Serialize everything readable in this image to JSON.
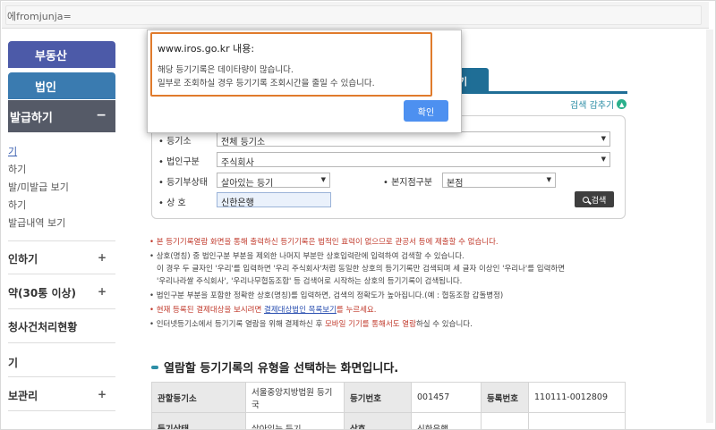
{
  "address_bar": {
    "url": "에fromjunja="
  },
  "sidebar": {
    "top_buttons": [
      "부동산",
      "법인"
    ],
    "active_section": {
      "label": "발급하기",
      "toggle": "−"
    },
    "sub_items": [
      "기",
      "하기",
      "발/미발급 보기",
      "하기",
      "발급내역 보기"
    ],
    "menus": [
      {
        "label": "인하기",
        "toggle": "+"
      },
      {
        "label": "약(30통 이상)",
        "toggle": "+"
      },
      {
        "label": "청사건처리현황",
        "toggle": ""
      },
      {
        "label": "기",
        "toggle": ""
      },
      {
        "label": "보관리",
        "toggle": "+"
      }
    ]
  },
  "tabs": {
    "partial_tab": "기"
  },
  "collapse_search": {
    "label": "검색 감추기"
  },
  "search_form": {
    "registry_office_label": "• 등기소",
    "registry_office_value": "전체 등기소",
    "corp_type_label": "• 법인구분",
    "corp_type_value": "주식회사",
    "registry_status_label": "• 등기부상태",
    "registry_status_value": "살아있는 등기",
    "branch_label": "• 본지점구분",
    "branch_value": "본점",
    "name_label": "• 상 호",
    "name_value": "신한은행",
    "search_button": "검색"
  },
  "notes": {
    "n1": "• 본 등기기록열람 화면을 통해 출력하신 등기기록은 법적인 효력이 없으므로 관공서 등에 제출할 수 없습니다.",
    "n2": "• 상호(명칭) 중 법인구분 부분을 제외한 나머지 부분만 상호입력란에 입력하여 검색할 수 있습니다.",
    "n3": "이 경우 두 글자인 '우리'를 입력하면 '우리 주식회사'처럼 동일한 상호의 등기기록만 검색되며 세 글자 이상인 '우리나'를 입력하면",
    "n4": "'우리나라쌀 주식회사', '우리나무협동조합' 등 검색어로 시작하는 상호의 등기기록이 검색됩니다.",
    "n5": "• 법인구분 부분을 포함한 정확한 상호(명칭)를 입력하면, 검색의 정확도가 높아집니다.(예 : 협동조합 갑돌병정)",
    "n6_red_a": "• 현재 등록된 결제대상을 보시려면 ",
    "n6_link": "결제대상법인 목록보기",
    "n6_red_b": "를 누르세요.",
    "n7_a": "• 인터넷등기소에서 등기기록 열람을 위해 결제하신 후 ",
    "n7_red": "모바일 기기를 통해서도 열람",
    "n7_b": "하실 수 있습니다."
  },
  "section_title": "열람할 등기기록의 유형을 선택하는 화면입니다.",
  "info_table": {
    "row1": [
      "관할등기소",
      "서울중앙지방법원 등기국",
      "등기번호",
      "001457",
      "등록번호",
      "110111-0012809"
    ],
    "row2": [
      "등기상태",
      "살아있는 등기",
      "상호",
      "신한은행",
      "",
      ""
    ]
  },
  "dialog": {
    "title": "www.iros.go.kr 내용:",
    "message_line1": "해당 등기기록은 데이타량이 많습니다.",
    "message_line2": "일부로 조회하실 경우 등기기록 조회시간을 줄일 수 있습니다.",
    "ok_button": "확인"
  },
  "colors": {
    "accent_blue": "#4c5aa8",
    "tab_blue": "#1f6e96",
    "highlight_orange": "#e07b2c",
    "ok_button": "#4d90f0",
    "note_red": "#c0392b"
  }
}
